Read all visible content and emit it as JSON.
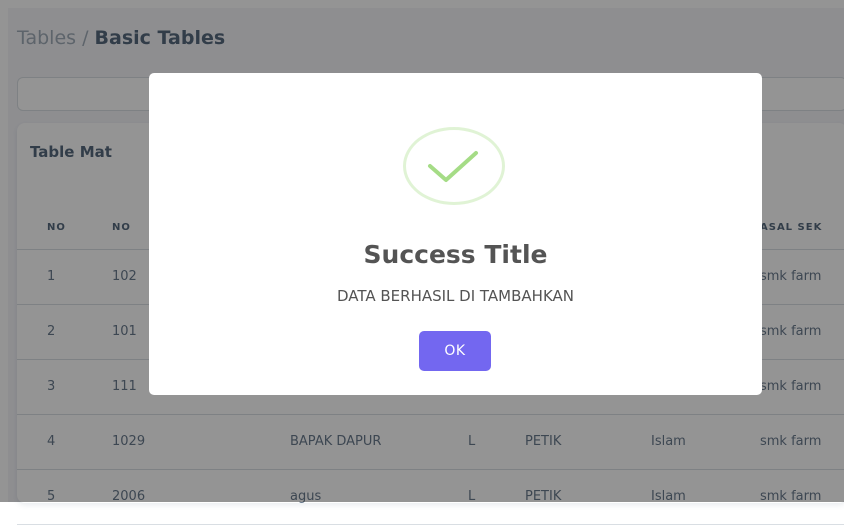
{
  "breadcrumb": {
    "parent": "Tables /",
    "current": "Basic Tables"
  },
  "card": {
    "title": "Table Mat"
  },
  "table": {
    "headers": [
      "NO",
      "NO",
      "",
      "",
      "",
      "",
      "ASAL SEK"
    ],
    "rows": [
      [
        "1",
        "102",
        "",
        "",
        "",
        "",
        "smk farm"
      ],
      [
        "2",
        "101",
        "",
        "",
        "",
        "",
        "smk farm"
      ],
      [
        "3",
        "111",
        "",
        "",
        "",
        "",
        "smk farm"
      ],
      [
        "4",
        "1029",
        "BAPAK DAPUR",
        "L",
        "PETIK",
        "Islam",
        "smk farm"
      ],
      [
        "5",
        "2006",
        "agus",
        "L",
        "PETIK",
        "Islam",
        "smk farm"
      ]
    ]
  },
  "modal": {
    "icon": "success-check-icon",
    "title": "Success Title",
    "text": "DATA BERHASIL DI TAMBAHKAN",
    "ok_label": "OK",
    "accent_color": "#7367f0",
    "success_color": "#a5dc86"
  }
}
